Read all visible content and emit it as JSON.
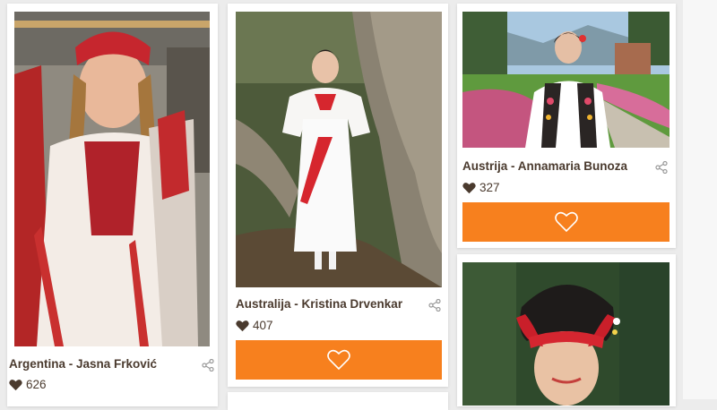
{
  "cards": [
    {
      "name": "Argentina - Jasna Frković",
      "likes": "626",
      "photo": "girl-in-red-folk-costume-with-braids"
    },
    {
      "name": "Australija - Kristina Drvenkar",
      "likes": "407",
      "photo": "woman-in-white-folk-dress-under-tree"
    },
    {
      "name": "Austrija - Annamaria Bunoza",
      "likes": "327",
      "photo": "woman-in-folk-dress-in-garden"
    },
    {
      "name": "",
      "likes": "",
      "photo": "woman-with-red-black-folk-headdress"
    }
  ],
  "icons": {
    "share": "share-icon",
    "like": "heart-icon",
    "vote": "heart-outline-icon"
  },
  "colors": {
    "accent": "#f7801e",
    "text": "#4a3a2e",
    "background": "#ececec"
  }
}
